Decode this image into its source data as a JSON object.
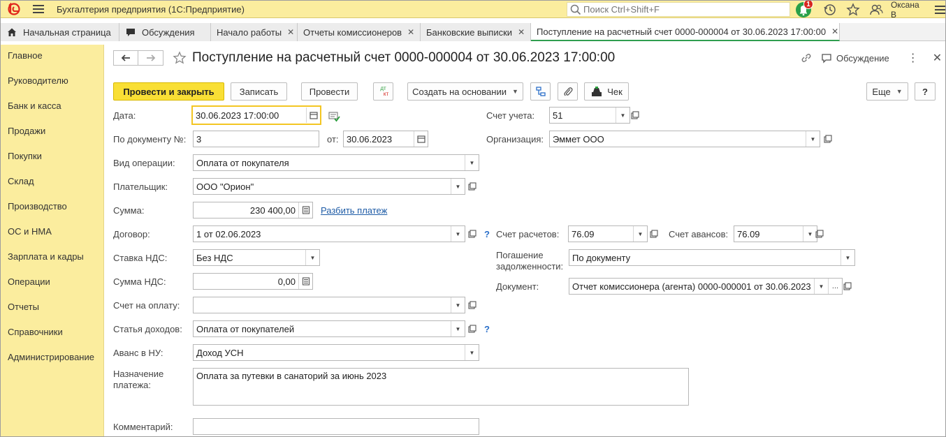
{
  "window": {
    "app_title": "Бухгалтерия предприятия  (1С:Предприятие)",
    "search_placeholder": "Поиск Ctrl+Shift+F",
    "notifications_count": "1",
    "user_name": "Оксана В"
  },
  "tabs": [
    {
      "label": "Начальная страница"
    },
    {
      "label": "Обсуждения"
    },
    {
      "label": "Начало работы"
    },
    {
      "label": "Отчеты комиссионеров"
    },
    {
      "label": "Банковские выписки"
    },
    {
      "label": "Поступление на расчетный счет 0000-000004 от 30.06.2023 17:00:00"
    }
  ],
  "sidebar": {
    "items": [
      {
        "label": "Главное"
      },
      {
        "label": "Руководителю"
      },
      {
        "label": "Банк и касса"
      },
      {
        "label": "Продажи"
      },
      {
        "label": "Покупки"
      },
      {
        "label": "Склад"
      },
      {
        "label": "Производство"
      },
      {
        "label": "ОС и НМА"
      },
      {
        "label": "Зарплата и кадры"
      },
      {
        "label": "Операции"
      },
      {
        "label": "Отчеты"
      },
      {
        "label": "Справочники"
      },
      {
        "label": "Администрирование"
      }
    ]
  },
  "document": {
    "title": "Поступление на расчетный счет 0000-000004 от 30.06.2023 17:00:00",
    "discussion_label": "Обсуждение"
  },
  "toolbar": {
    "post_close": "Провести и закрыть",
    "save": "Записать",
    "post": "Провести",
    "dt_kt_top": "дт",
    "dt_kt_bottom": "кт",
    "create_based": "Создать на основании",
    "receipt": "Чек",
    "more": "Еще",
    "help": "?"
  },
  "form": {
    "date_label": "Дата:",
    "date_value": "30.06.2023 17:00:00",
    "docnum_label": "По документу №:",
    "docnum_value": "3",
    "from_label": "от:",
    "from_value": "30.06.2023",
    "optype_label": "Вид операции:",
    "optype_value": "Оплата от покупателя",
    "payer_label": "Плательщик:",
    "payer_value": "ООО \"Орион\"",
    "sum_label": "Сумма:",
    "sum_value": "230 400,00",
    "split_link": "Разбить платеж",
    "contract_label": "Договор:",
    "contract_value": "1 от 02.06.2023",
    "vat_rate_label": "Ставка НДС:",
    "vat_rate_value": "Без НДС",
    "vat_sum_label": "Сумма НДС:",
    "vat_sum_value": "0,00",
    "invoice_label": "Счет на оплату:",
    "invoice_value": "",
    "income_label": "Статья доходов:",
    "income_value": "Оплата от покупателей",
    "advance_label": "Аванс в НУ:",
    "advance_value": "Доход УСН",
    "purpose_label_1": "Назначение",
    "purpose_label_2": "платежа:",
    "purpose_value": "Оплата за путевки в санаторий за июнь 2023",
    "comment_label": "Комментарий:",
    "comment_value": "",
    "account_label": "Счет учета:",
    "account_value": "51",
    "org_label": "Организация:",
    "org_value": "Эммет ООО",
    "settle_label": "Счет расчетов:",
    "settle_value": "76.09",
    "adv_acc_label": "Счет авансов:",
    "adv_acc_value": "76.09",
    "repay_label_1": "Погашение",
    "repay_label_2": "задолженности:",
    "repay_value": "По документу",
    "document_label": "Документ:",
    "document_value": "Отчет комиссионера (агента) 0000-000001 от 30.06.2023",
    "help_mark": "?",
    "ellipsis": "..."
  },
  "colors": {
    "accent_yellow": "#fbed9e",
    "primary_button": "#f9df35",
    "active_tab_line": "#2f9e4f",
    "notification_green": "#2aa04a",
    "badge_red": "#d7261e",
    "link_blue": "#1d5ba6"
  }
}
